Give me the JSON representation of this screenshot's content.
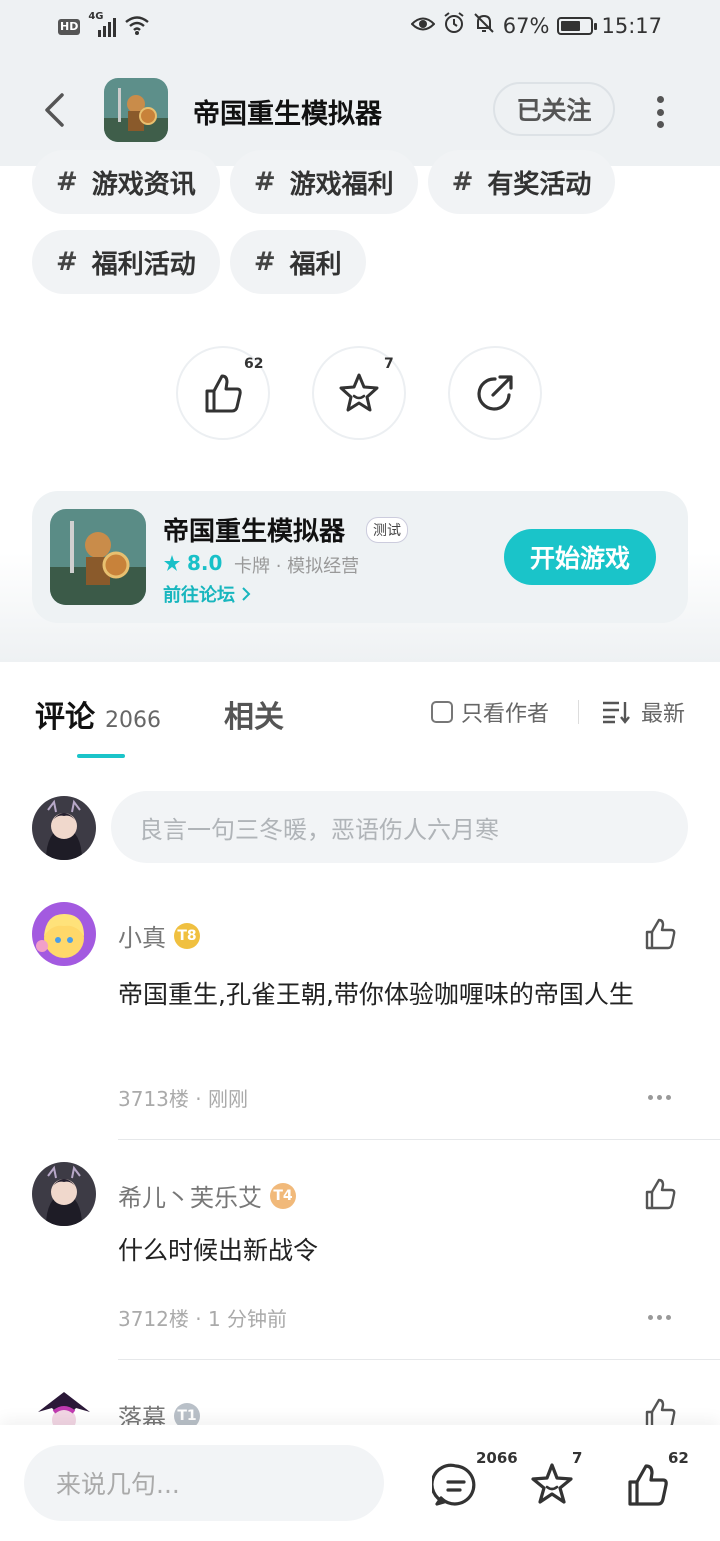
{
  "status_bar": {
    "hd": "HD",
    "network": "4G",
    "battery_pct": "67%",
    "battery_level": 0.67,
    "time": "15:17"
  },
  "header": {
    "title": "帝国重生模拟器",
    "follow_label": "已关注"
  },
  "tags": [
    {
      "hash": "#",
      "label": "游戏资讯"
    },
    {
      "hash": "#",
      "label": "游戏福利"
    },
    {
      "hash": "#",
      "label": "有奖活动"
    },
    {
      "hash": "#",
      "label": "福利活动"
    },
    {
      "hash": "#",
      "label": "福利"
    }
  ],
  "actions": {
    "like_count": "62",
    "fav_count": "7"
  },
  "game_card": {
    "title": "帝国重生模拟器",
    "badge": "测试",
    "score": "8.0",
    "categories": "卡牌 · 模拟经营",
    "forum_link": "前往论坛",
    "play_label": "开始游戏"
  },
  "tabs": {
    "comments_label": "评论",
    "comments_count": "2066",
    "related_label": "相关",
    "only_author": "只看作者",
    "sort_label": "最新"
  },
  "comment_input": {
    "placeholder": "良言一句三冬暖，恶语伤人六月寒"
  },
  "comments": [
    {
      "name": "小真",
      "level": "T8",
      "text": "帝国重生,孔雀王朝,带你体验咖喱味的帝国人生",
      "floor_time": "3713楼 · 刚刚"
    },
    {
      "name": "希儿丶芙乐艾",
      "level": "T4",
      "text": "什么时候出新战令",
      "floor_time": "3712楼 · 1 分钟前"
    },
    {
      "name": "落幕",
      "level": "T1"
    }
  ],
  "bottom_bar": {
    "placeholder": "来说几句...",
    "comment_count": "2066",
    "fav_count": "7",
    "like_count": "62"
  },
  "colors": {
    "accent": "#1ac4c9",
    "header_bg": "#eef1f3"
  }
}
